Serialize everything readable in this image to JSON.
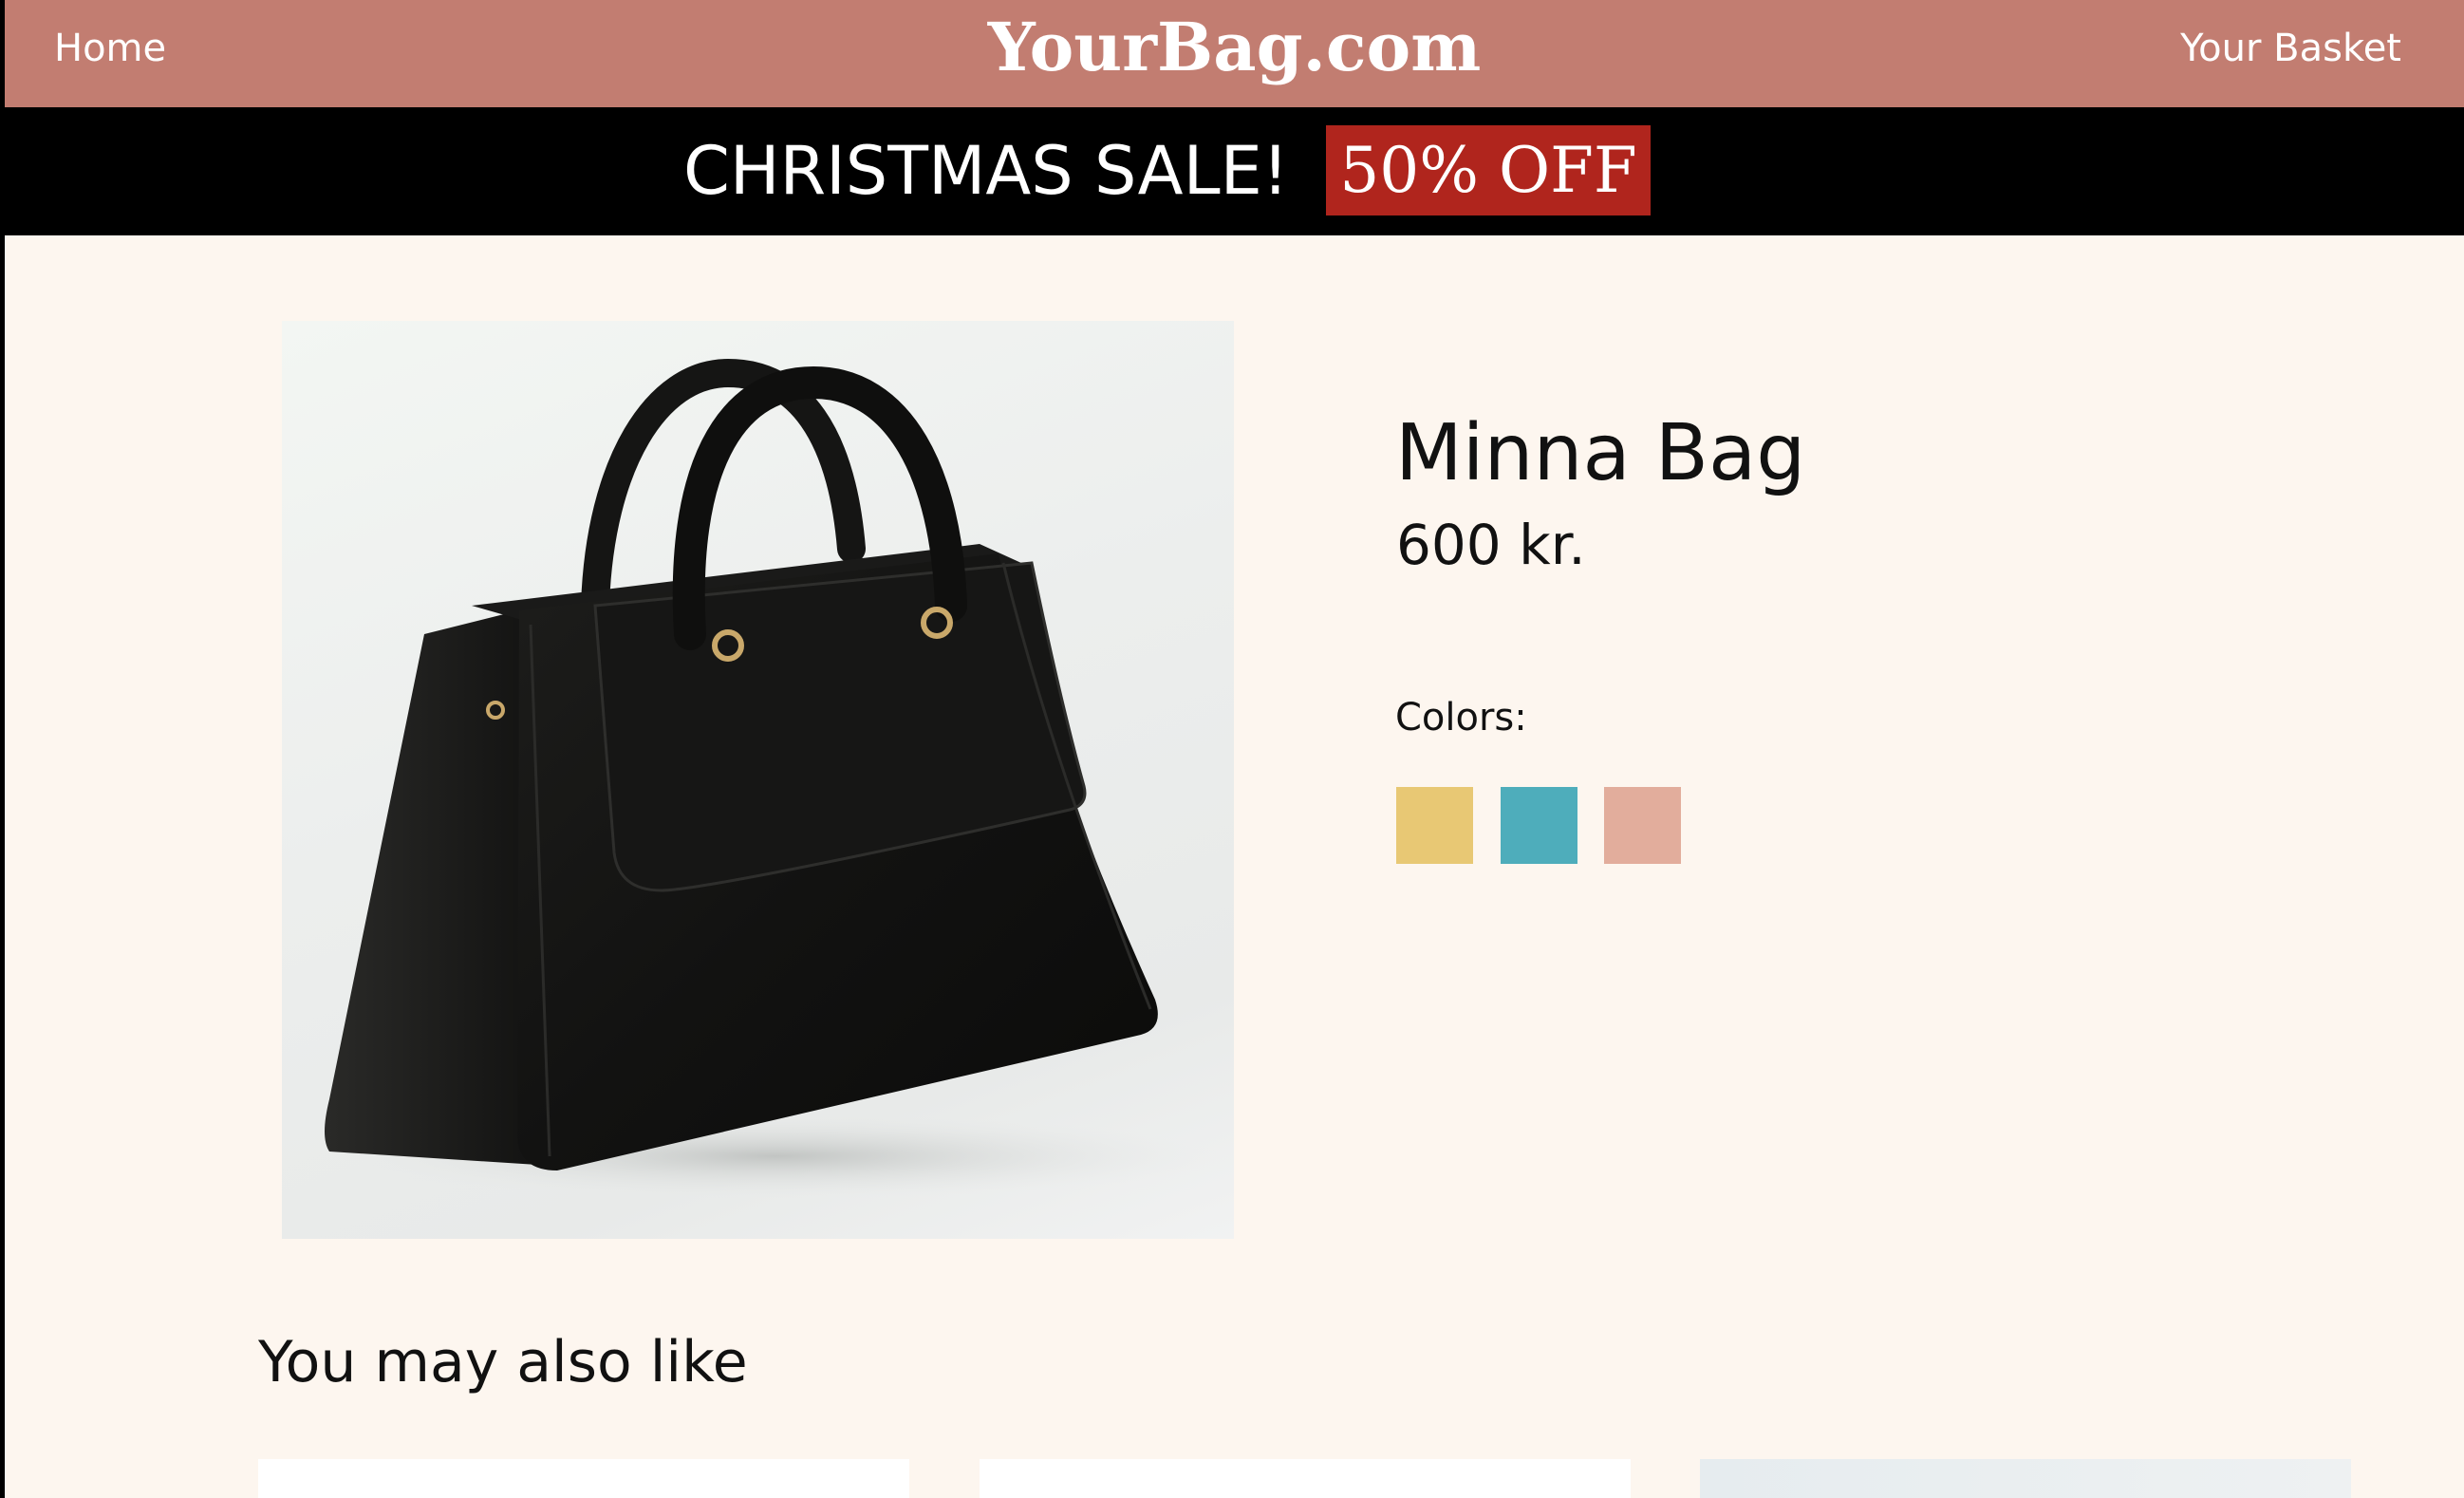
{
  "header": {
    "home_label": "Home",
    "brand": "YourBag.com",
    "basket_label": "Your Basket"
  },
  "banner": {
    "sale_text": "CHRISTMAS SALE!",
    "badge_text": "50% OFF"
  },
  "product": {
    "name": "Minna Bag",
    "price": "600 kr.",
    "colors_label": "Colors:",
    "colors": [
      "#e8c874",
      "#4eadbb",
      "#e2ad9c"
    ]
  },
  "recommendations": {
    "heading": "You may also like"
  },
  "theme": {
    "header_bg": "#c27d71",
    "sale_bar_bg": "#000000",
    "badge_bg": "#b0251d",
    "page_bg": "#fdf6ef"
  }
}
